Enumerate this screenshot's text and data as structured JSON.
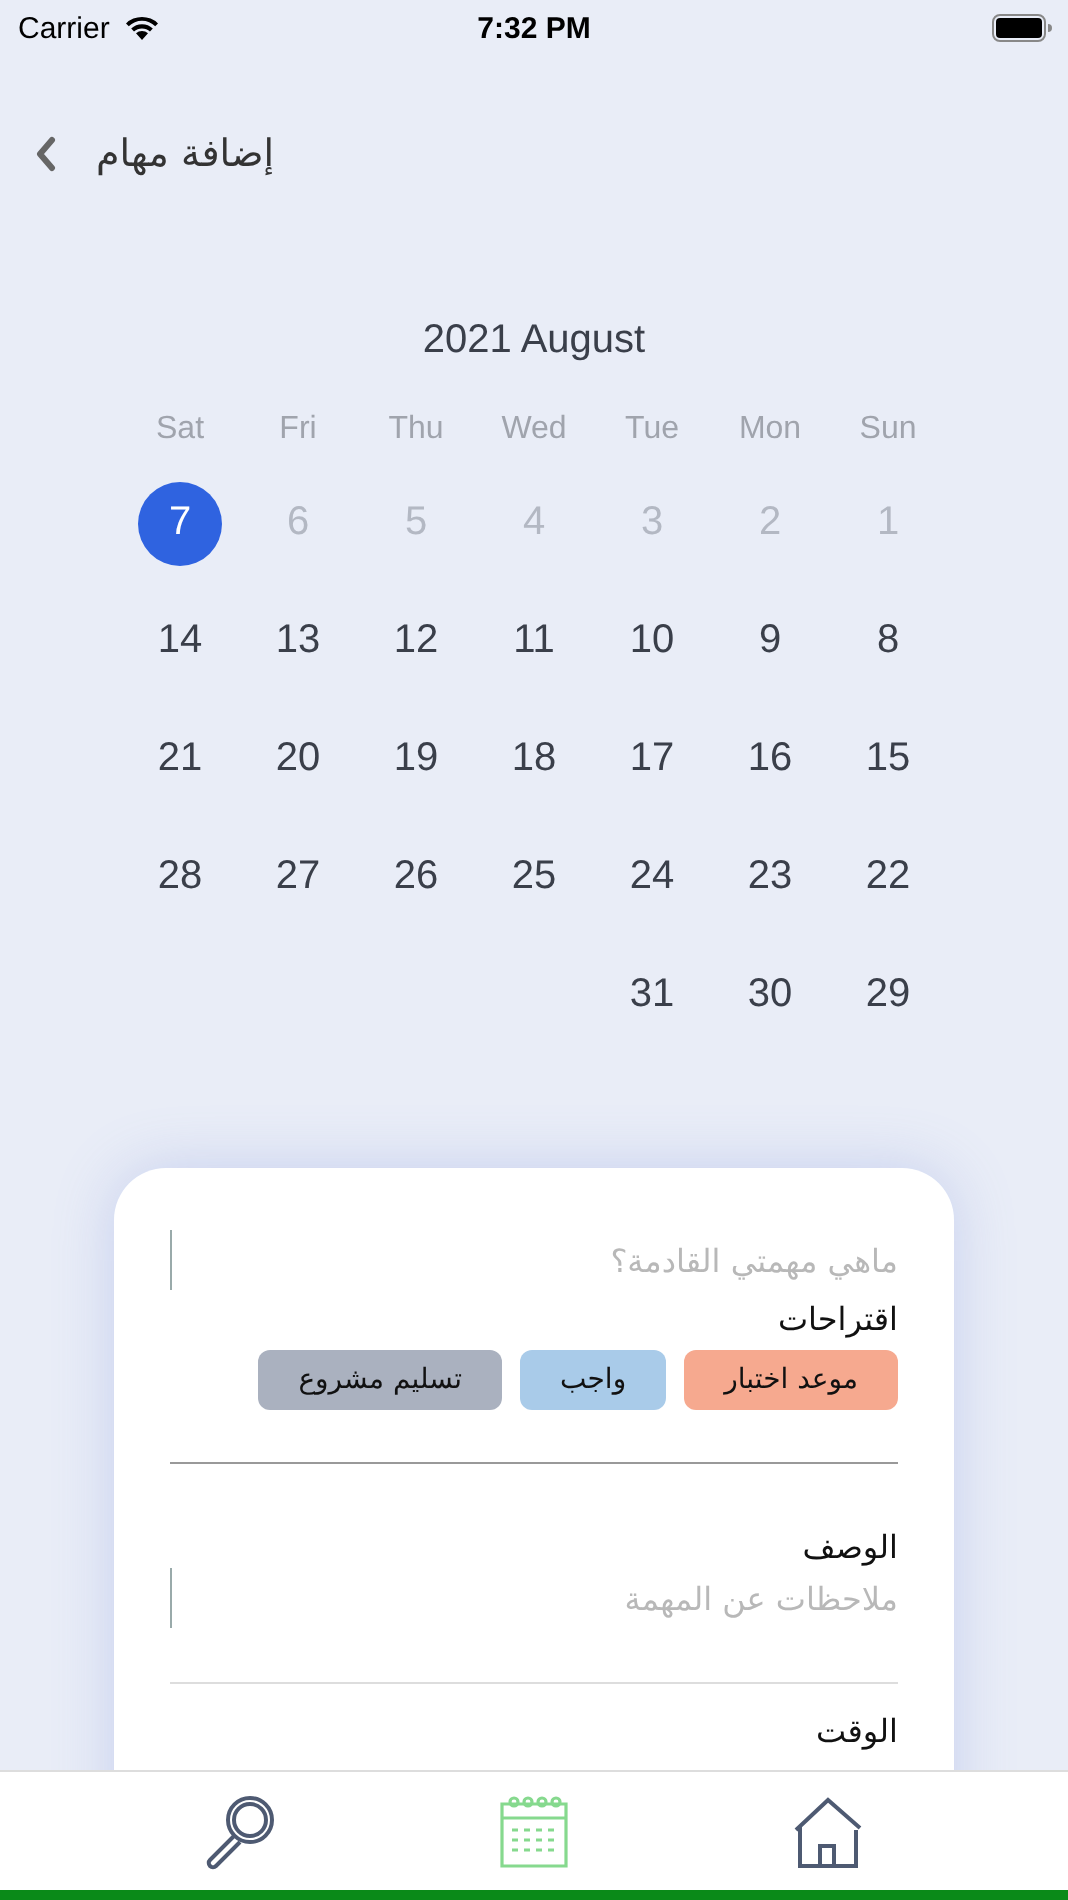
{
  "status_bar": {
    "carrier": "Carrier",
    "time": "7:32 PM"
  },
  "header": {
    "title": "إضافة مهام"
  },
  "calendar": {
    "title": "2021 August",
    "weekdays": [
      "Sun",
      "Mon",
      "Tue",
      "Wed",
      "Thu",
      "Fri",
      "Sat"
    ],
    "weeks": [
      {
        "days": [
          {
            "label": "1",
            "disabled": true,
            "selected": false
          },
          {
            "label": "2",
            "disabled": true,
            "selected": false
          },
          {
            "label": "3",
            "disabled": true,
            "selected": false
          },
          {
            "label": "4",
            "disabled": true,
            "selected": false
          },
          {
            "label": "5",
            "disabled": true,
            "selected": false
          },
          {
            "label": "6",
            "disabled": true,
            "selected": false
          },
          {
            "label": "7",
            "disabled": false,
            "selected": true
          }
        ]
      },
      {
        "days": [
          {
            "label": "8",
            "disabled": false,
            "selected": false
          },
          {
            "label": "9",
            "disabled": false,
            "selected": false
          },
          {
            "label": "10",
            "disabled": false,
            "selected": false
          },
          {
            "label": "11",
            "disabled": false,
            "selected": false
          },
          {
            "label": "12",
            "disabled": false,
            "selected": false
          },
          {
            "label": "13",
            "disabled": false,
            "selected": false
          },
          {
            "label": "14",
            "disabled": false,
            "selected": false
          }
        ]
      },
      {
        "days": [
          {
            "label": "15",
            "disabled": false,
            "selected": false
          },
          {
            "label": "16",
            "disabled": false,
            "selected": false
          },
          {
            "label": "17",
            "disabled": false,
            "selected": false
          },
          {
            "label": "18",
            "disabled": false,
            "selected": false
          },
          {
            "label": "19",
            "disabled": false,
            "selected": false
          },
          {
            "label": "20",
            "disabled": false,
            "selected": false
          },
          {
            "label": "21",
            "disabled": false,
            "selected": false
          }
        ]
      },
      {
        "days": [
          {
            "label": "22",
            "disabled": false,
            "selected": false
          },
          {
            "label": "23",
            "disabled": false,
            "selected": false
          },
          {
            "label": "24",
            "disabled": false,
            "selected": false
          },
          {
            "label": "25",
            "disabled": false,
            "selected": false
          },
          {
            "label": "26",
            "disabled": false,
            "selected": false
          },
          {
            "label": "27",
            "disabled": false,
            "selected": false
          },
          {
            "label": "28",
            "disabled": false,
            "selected": false
          }
        ]
      },
      {
        "days": [
          {
            "label": "29",
            "disabled": false,
            "selected": false
          },
          {
            "label": "30",
            "disabled": false,
            "selected": false
          },
          {
            "label": "31",
            "disabled": false,
            "selected": false
          }
        ]
      }
    ]
  },
  "task_form": {
    "title_field": {
      "placeholder": "ماهي  مهمتي القادمة؟"
    },
    "suggestions_label": "اقتراحات",
    "suggestions": [
      {
        "label": "موعد اختبار",
        "color": "#f6a98f"
      },
      {
        "label": "واجب",
        "color": "#a9cbe9"
      },
      {
        "label": "تسليم مشروع",
        "color": "#aab1bf"
      }
    ],
    "description_label": "الوصف",
    "description_field": {
      "placeholder": "ملاحظات عن المهمة"
    },
    "time_label": "الوقت"
  },
  "tab_bar": [
    {
      "kind": "home",
      "selected": false
    },
    {
      "kind": "calendar",
      "selected": true
    },
    {
      "kind": "search",
      "selected": false
    }
  ]
}
